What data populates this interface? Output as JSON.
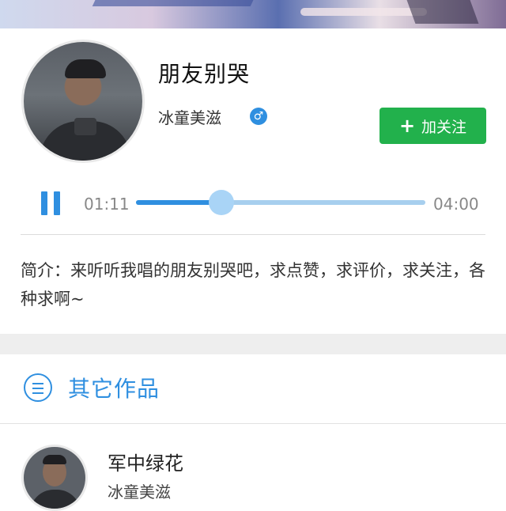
{
  "song": {
    "title": "朋友别哭",
    "artist": "冰童美滋",
    "gender_icon": "male-icon",
    "follow_label": "加关注"
  },
  "player": {
    "current_time": "01:11",
    "total_time": "04:00",
    "progress": 0.296,
    "state_icon": "pause-icon"
  },
  "intro": {
    "text": "简介：来听听我唱的朋友别哭吧，求点赞，求评价，求关注，各种求啊~"
  },
  "other_works": {
    "heading": "其它作品",
    "heading_icon": "list-icon",
    "items": [
      {
        "title": "军中绿花",
        "artist": "冰童美滋"
      }
    ]
  },
  "colors": {
    "accent": "#2f8fe0",
    "follow_button": "#22b14c",
    "track": "#a7cfee"
  }
}
